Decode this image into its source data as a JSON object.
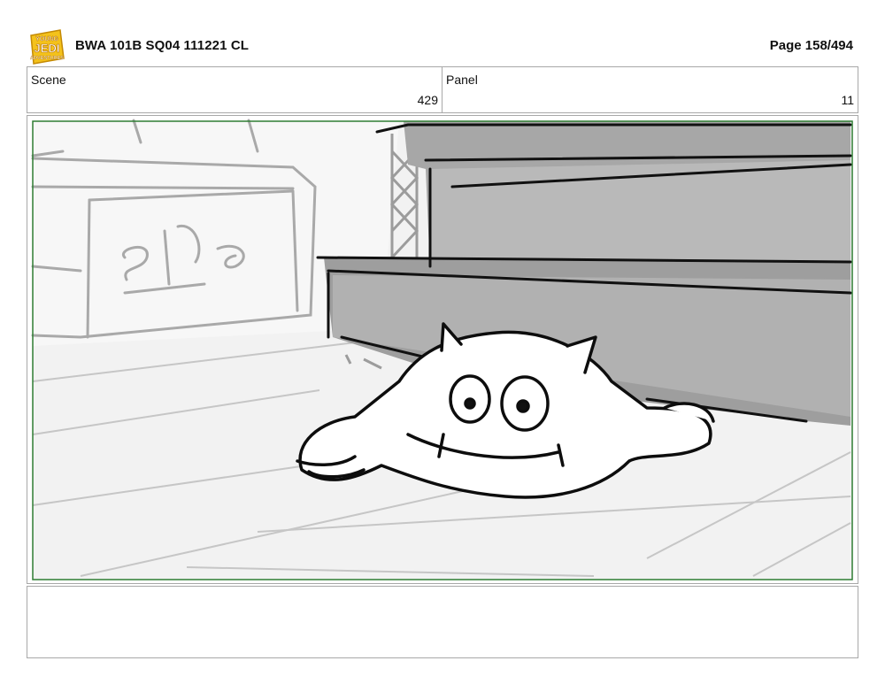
{
  "header": {
    "logo_lines": [
      "YOUNG",
      "JEDI",
      "ADVENTURES"
    ],
    "title": "BWA 101B SQ04 111221 CL",
    "page": "Page 158/494"
  },
  "info": {
    "scene_label": "Scene",
    "scene_value": "429",
    "panel_label": "Panel",
    "panel_value": "11"
  },
  "frame": {
    "border_color": "#2e7d32"
  },
  "notes": {
    "text": ""
  }
}
